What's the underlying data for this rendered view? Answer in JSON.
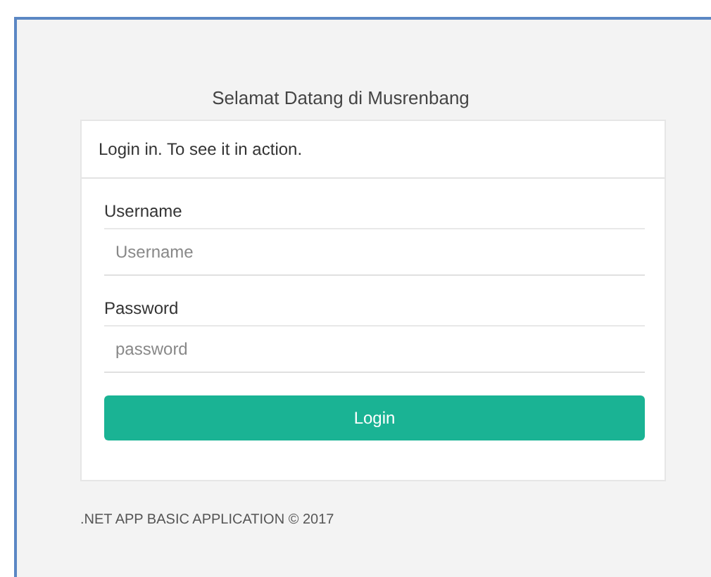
{
  "title": "Selamat Datang di Musrenbang",
  "card": {
    "header": "Login in. To see it in action.",
    "fields": [
      {
        "label": "Username",
        "placeholder": "Username"
      },
      {
        "label": "Password",
        "placeholder": "password"
      }
    ],
    "button": "Login"
  },
  "footer": ".NET APP BASIC APPLICATION © 2017"
}
